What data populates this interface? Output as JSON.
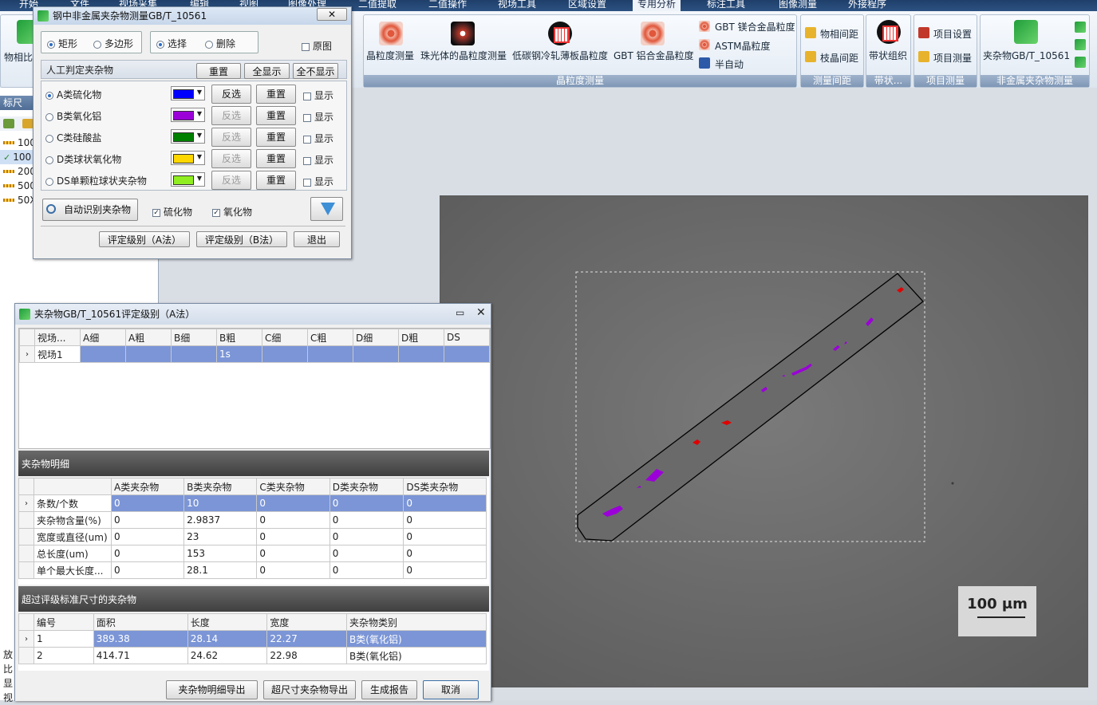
{
  "tabs": [
    "开始",
    "文件",
    "视场采集",
    "编辑",
    "视图",
    "图像处理",
    "二值提取",
    "二值操作",
    "视场工具",
    "区域设置",
    "专用分析",
    "标注工具",
    "图像测量",
    "外接程序"
  ],
  "active_tab_index": 10,
  "ribbon": {
    "left_button": "物相比",
    "grain_group": {
      "label": "晶粒度测量",
      "buttons": [
        "晶粒度测量",
        "珠光体的晶粒度测量",
        "低碳钢冷轧薄板晶粒度",
        "GBT 铝合金晶粒度"
      ],
      "small_buttons": [
        "GBT 镁合金晶粒度",
        "ASTM晶粒度",
        "半自动"
      ]
    },
    "spacing_group": {
      "label": "测量间距",
      "buttons": [
        "物相间距",
        "枝晶间距"
      ]
    },
    "band_group": {
      "label": "带状...",
      "button": "带状组织"
    },
    "project_group": {
      "label": "项目测量",
      "buttons": [
        "项目设置",
        "项目测量"
      ]
    },
    "inclusion_group": {
      "label": "非金属夹杂物测量",
      "button": "夹杂物GB/T_10561"
    }
  },
  "left_panel": {
    "title": "标尺",
    "items": [
      "100",
      "100",
      "200",
      "500",
      "50X"
    ],
    "bottom_labels": [
      "放",
      "比",
      "显",
      "视"
    ]
  },
  "scale_label": "100 μm",
  "measure_dialog": {
    "title": "钢中非金属夹杂物测量GB/T_10561",
    "shape_options": [
      "矩形",
      "多边形"
    ],
    "mode_options": [
      "选择",
      "删除"
    ],
    "original_label": "原图",
    "manual_label": "人工判定夹杂物",
    "reset_label": "重置",
    "show_all_label": "全显示",
    "hide_all_label": "全不显示",
    "categories": [
      {
        "name": "A类硫化物",
        "color": "#0000ff",
        "invert": "反选",
        "reset": "重置",
        "show": "显示",
        "invert_enabled": true
      },
      {
        "name": "B类氧化铝",
        "color": "#9b00d9",
        "invert": "反选",
        "reset": "重置",
        "show": "显示",
        "invert_enabled": false
      },
      {
        "name": "C类硅酸盐",
        "color": "#008000",
        "invert": "反选",
        "reset": "重置",
        "show": "显示",
        "invert_enabled": false
      },
      {
        "name": "D类球状氧化物",
        "color": "#ffd700",
        "invert": "反选",
        "reset": "重置",
        "show": "显示",
        "invert_enabled": false
      },
      {
        "name": "DS单颗粒球状夹杂物",
        "color": "#90ee20",
        "invert": "反选",
        "reset": "重置",
        "show": "显示",
        "invert_enabled": false
      }
    ],
    "auto_detect_label": "自动识别夹杂物",
    "sulfide_label": "硫化物",
    "oxide_label": "氧化物",
    "rate_a_label": "评定级别（A法）",
    "rate_b_label": "评定级别（B法）",
    "exit_label": "退出"
  },
  "rating_dialog": {
    "title": "夹杂物GB/T_10561评定级别（A法）",
    "grade_headers": [
      "视场...",
      "A细",
      "A粗",
      "B细",
      "B粗",
      "C细",
      "C粗",
      "D细",
      "D粗",
      "DS"
    ],
    "grade_rows": [
      [
        "视场1",
        "",
        "",
        "",
        "1s",
        "",
        "",
        "",
        "",
        ""
      ]
    ],
    "detail_title": "夹杂物明细",
    "detail_headers": [
      "",
      "A类夹杂物",
      "B类夹杂物",
      "C类夹杂物",
      "D类夹杂物",
      "DS类夹杂物"
    ],
    "detail_rows": [
      [
        "条数/个数",
        "0",
        "10",
        "0",
        "0",
        "0"
      ],
      [
        "夹杂物含量(%)",
        "0",
        "2.9837",
        "0",
        "0",
        "0"
      ],
      [
        "宽度或直径(um)",
        "0",
        "23",
        "0",
        "0",
        "0"
      ],
      [
        "总长度(um)",
        "0",
        "153",
        "0",
        "0",
        "0"
      ],
      [
        "单个最大长度...",
        "0",
        "28.1",
        "0",
        "0",
        "0"
      ]
    ],
    "oversize_title": "超过评级标准尺寸的夹杂物",
    "oversize_headers": [
      "编号",
      "面积",
      "长度",
      "宽度",
      "夹杂物类别"
    ],
    "oversize_rows": [
      [
        "1",
        "389.38",
        "28.14",
        "22.27",
        "B类(氧化铝)"
      ],
      [
        "2",
        "414.71",
        "24.62",
        "22.98",
        "B类(氧化铝)"
      ]
    ],
    "buttons": [
      "夹杂物明细导出",
      "超尺寸夹杂物导出",
      "生成报告",
      "取消"
    ]
  }
}
